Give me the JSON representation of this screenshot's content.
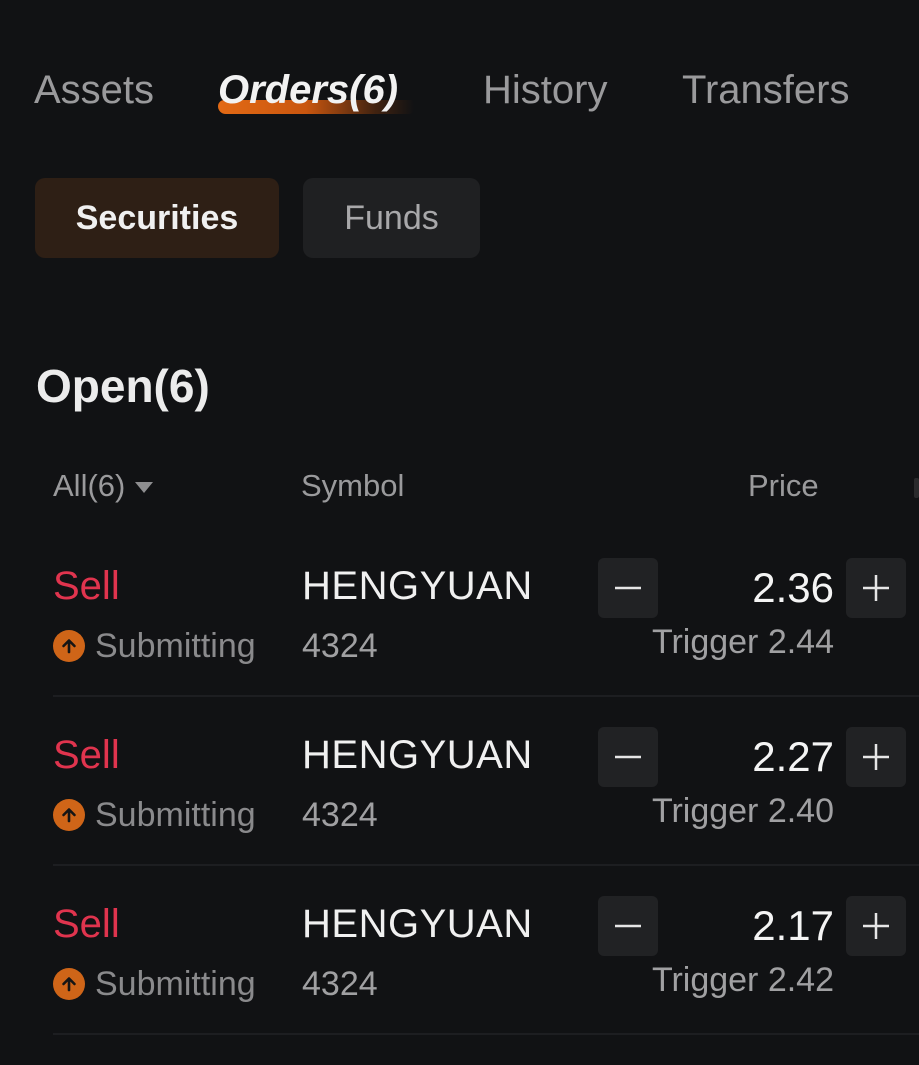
{
  "tabs": [
    {
      "label": "Assets",
      "active": false
    },
    {
      "label": "Orders(6)",
      "active": true
    },
    {
      "label": "History",
      "active": false
    },
    {
      "label": "Transfers",
      "active": false
    }
  ],
  "segments": [
    {
      "label": "Securities",
      "active": true
    },
    {
      "label": "Funds",
      "active": false
    }
  ],
  "section": {
    "title": "Open(6)"
  },
  "columns": {
    "filter": "All(6)",
    "symbol": "Symbol",
    "price": "Price"
  },
  "colors": {
    "accent": "#e36a15",
    "sell": "#e0344e",
    "status_icon": "#cf6518",
    "background": "#111214"
  },
  "orders": [
    {
      "side": "Sell",
      "status": "Submitting",
      "status_icon": "arrow-up-circle-icon",
      "symbol": "HENGYUAN",
      "code": "4324",
      "price": "2.36",
      "trigger": "Trigger 2.44"
    },
    {
      "side": "Sell",
      "status": "Submitting",
      "status_icon": "arrow-up-circle-icon",
      "symbol": "HENGYUAN",
      "code": "4324",
      "price": "2.27",
      "trigger": "Trigger 2.40"
    },
    {
      "side": "Sell",
      "status": "Submitting",
      "status_icon": "arrow-up-circle-icon",
      "symbol": "HENGYUAN",
      "code": "4324",
      "price": "2.17",
      "trigger": "Trigger 2.42"
    }
  ]
}
